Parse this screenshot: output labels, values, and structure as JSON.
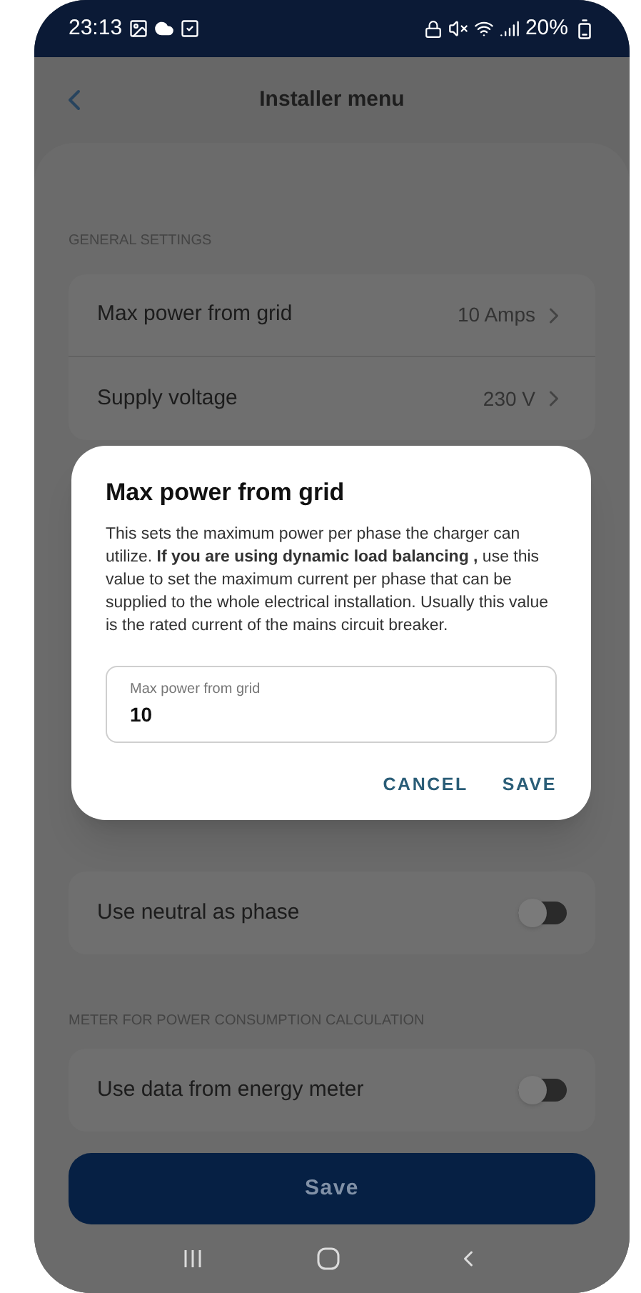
{
  "status_bar": {
    "time": "23:13",
    "battery": "20%"
  },
  "header": {
    "title": "Installer menu"
  },
  "sections": [
    {
      "label": "GENERAL SETTINGS",
      "rows": [
        {
          "kind": "link",
          "label": "Max power from grid",
          "value": "10 Amps"
        },
        {
          "kind": "link",
          "label": "Supply voltage",
          "value": "230 V"
        }
      ]
    },
    {
      "rows": [
        {
          "kind": "toggle",
          "label": "Use neutral as phase",
          "on": false
        }
      ]
    },
    {
      "label": "METER FOR POWER CONSUMPTION CALCULATION",
      "rows": [
        {
          "kind": "toggle",
          "label": "Use data from energy meter",
          "on": false
        }
      ]
    }
  ],
  "save_button": "Save",
  "dialog": {
    "title": "Max power from grid",
    "body": "This sets the maximum power per phase the charger can utilize. **If you are using dynamic load balancing ,** use this value to set the maximum current per phase that can be supplied to the whole electrical installation. Usually this value is the rated current of the mains circuit breaker.",
    "field": {
      "label": "Max power from grid",
      "value": "10"
    },
    "buttons": [
      "CANCEL",
      "SAVE"
    ]
  }
}
